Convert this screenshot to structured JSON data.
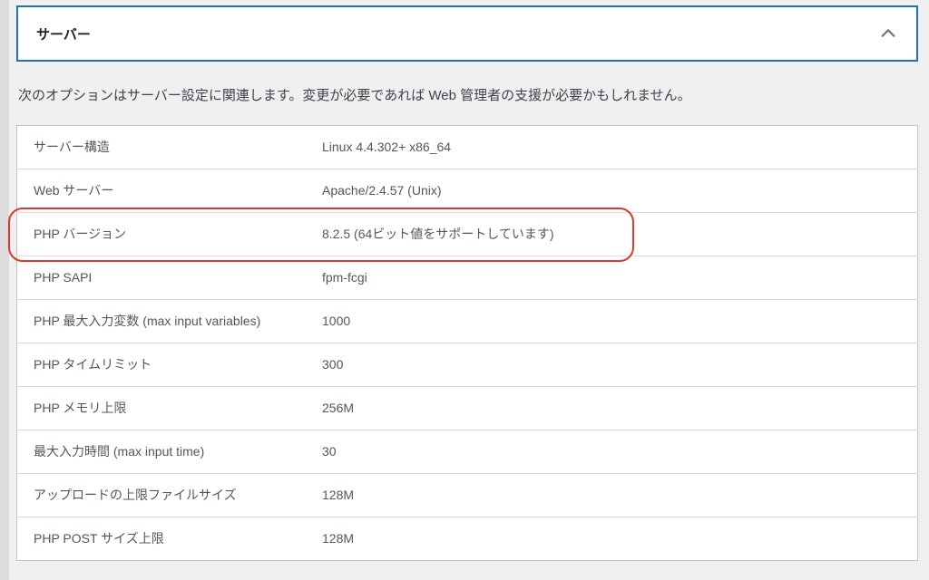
{
  "panel": {
    "title": "サーバー",
    "expanded": true
  },
  "description": "次のオプションはサーバー設定に関連します。変更が必要であれば Web 管理者の支援が必要かもしれません。",
  "rows": [
    {
      "label": "サーバー構造",
      "value": "Linux 4.4.302+ x86_64"
    },
    {
      "label": "Web サーバー",
      "value": "Apache/2.4.57 (Unix)"
    },
    {
      "label": "PHP バージョン",
      "value": "8.2.5 (64ビット値をサポートしています)"
    },
    {
      "label": "PHP SAPI",
      "value": "fpm-fcgi"
    },
    {
      "label": "PHP 最大入力変数 (max input variables)",
      "value": "1000"
    },
    {
      "label": "PHP タイムリミット",
      "value": "300"
    },
    {
      "label": "PHP メモリ上限",
      "value": "256M"
    },
    {
      "label": "最大入力時間 (max input time)",
      "value": "30"
    },
    {
      "label": "アップロードの上限ファイルサイズ",
      "value": "128M"
    },
    {
      "label": "PHP POST サイズ上限",
      "value": "128M"
    }
  ],
  "highlighted_row_index": 2,
  "colors": {
    "accent": "#2271b1",
    "highlight": "#d53a2e"
  }
}
